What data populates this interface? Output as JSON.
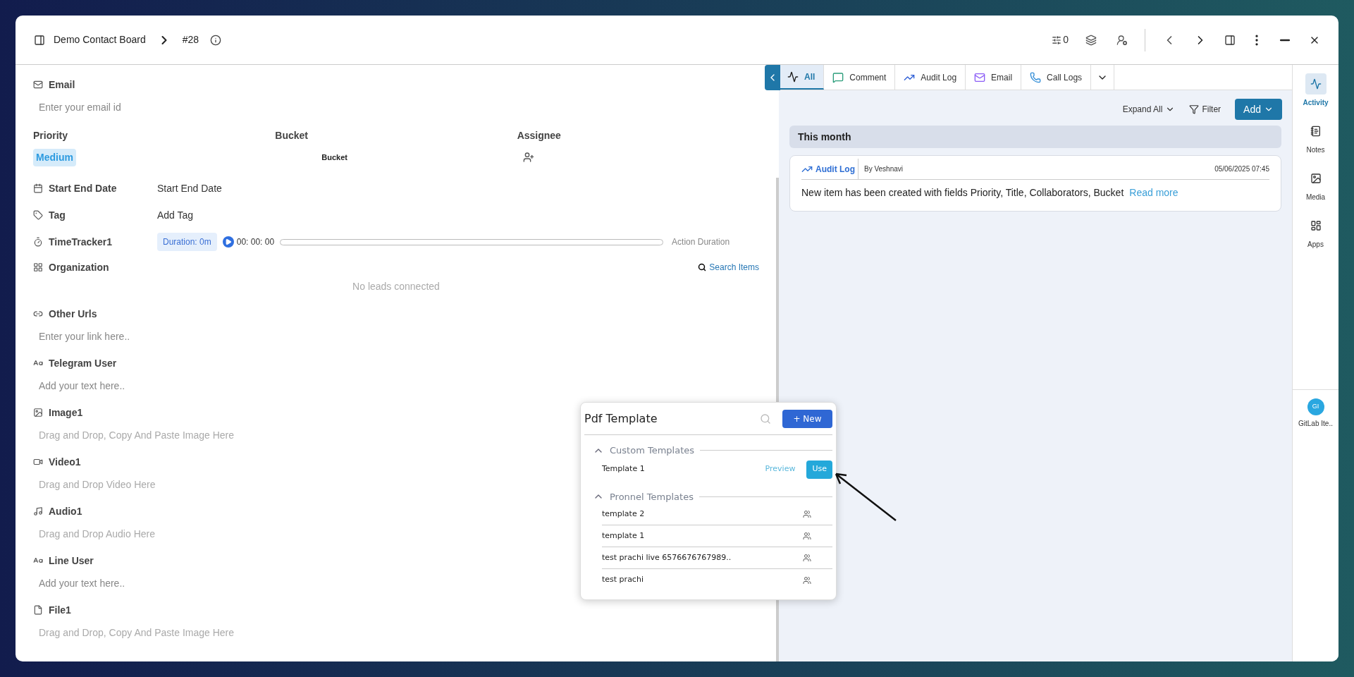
{
  "header": {
    "board": "Demo Contact Board",
    "item_id": "#28",
    "counter": "0"
  },
  "fields": [
    {
      "kind": "input",
      "label": "Email",
      "placeholder": "Enter your email id"
    },
    {
      "kind": "columns",
      "columns": [
        {
          "label": "Priority",
          "value": "Medium"
        },
        {
          "label": "Bucket",
          "value": "Bucket"
        },
        {
          "label": "Assignee"
        }
      ]
    },
    {
      "kind": "inline",
      "label": "Start End Date",
      "value": "Start End Date"
    },
    {
      "kind": "inline",
      "label": "Tag",
      "value": "Add Tag"
    },
    {
      "kind": "timer",
      "label": "TimeTracker1",
      "duration": "Duration: 0m",
      "time": "00: 00: 00",
      "action": "Action Duration"
    },
    {
      "kind": "relation",
      "label": "Organization",
      "search": "Search Items",
      "empty": "No leads connected"
    },
    {
      "kind": "input",
      "label": "Other Urls",
      "placeholder": "Enter your link here.."
    },
    {
      "kind": "input",
      "label": "Telegram User",
      "placeholder": "Add your text here.."
    },
    {
      "kind": "drop",
      "label": "Image1",
      "hint": "Drag and Drop, Copy And Paste Image Here"
    },
    {
      "kind": "drop",
      "label": "Video1",
      "hint": "Drag and Drop Video Here"
    },
    {
      "kind": "drop",
      "label": "Audio1",
      "hint": "Drag and Drop Audio Here"
    },
    {
      "kind": "input",
      "label": "Line User",
      "placeholder": "Add your text here.."
    },
    {
      "kind": "drop",
      "label": "File1",
      "hint": "Drag and Drop, Copy And Paste Image Here"
    }
  ],
  "tabs": [
    {
      "label": "All",
      "selected": true
    },
    {
      "label": "Comment",
      "selected": false
    },
    {
      "label": "Audit Log",
      "selected": false
    },
    {
      "label": "Email",
      "selected": false
    },
    {
      "label": "Call Logs",
      "selected": false
    }
  ],
  "toolbar": {
    "expand": "Expand All",
    "filter": "Filter",
    "add": "Add"
  },
  "group": "This month",
  "entries": [
    {
      "type": "Audit Log",
      "by": "By Veshnavi",
      "date": "05/06/2025 07:45",
      "text": "New item has been created with fields Priority, Title, Collaborators, Bucket",
      "more": "Read more"
    }
  ],
  "rail": [
    {
      "label": "Activity",
      "selected": true
    },
    {
      "label": "Notes",
      "selected": false
    },
    {
      "label": "Media",
      "selected": false
    },
    {
      "label": "Apps",
      "selected": false
    }
  ],
  "rail_app": {
    "initials": "GI",
    "label": "GitLab Ite.."
  },
  "popup": {
    "title": "Pdf Template",
    "new": "+ New",
    "sections": [
      {
        "title": "Custom Templates",
        "expanded": true,
        "kind": "custom",
        "items": [
          {
            "name": "Template 1",
            "preview": "Preview",
            "use": "Use"
          }
        ]
      },
      {
        "title": "Pronnel Templates",
        "expanded": true,
        "kind": "shared",
        "items": [
          {
            "name": "template 2"
          },
          {
            "name": "template 1"
          },
          {
            "name": "test prachi live 6576676767989.."
          },
          {
            "name": "test prachi"
          }
        ]
      }
    ]
  }
}
